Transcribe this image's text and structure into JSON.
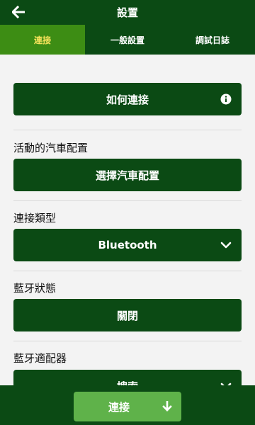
{
  "header": {
    "title": "設置",
    "back_icon": "arrow-left-icon"
  },
  "tabs": [
    {
      "label": "連接",
      "active": true
    },
    {
      "label": "一般設置",
      "active": false
    },
    {
      "label": "調試日誌",
      "active": false
    }
  ],
  "sections": {
    "how_to_connect": {
      "label": "如何連接",
      "icon": "info-icon"
    },
    "active_car_profile": {
      "label": "活動的汽車配置",
      "button": "選擇汽車配置"
    },
    "connection_type": {
      "label": "連接類型",
      "value": "Bluetooth",
      "icon": "chevron-down-icon"
    },
    "bluetooth_status": {
      "label": "藍牙狀態",
      "button": "關閉"
    },
    "bluetooth_adapter": {
      "label": "藍牙適配器",
      "button": "搜索"
    }
  },
  "footer": {
    "connect_label": "連接",
    "icon": "download-icon"
  },
  "colors": {
    "primary": "#0b4a14",
    "tab_active": "#3d8d14",
    "tab_active_text": "#f5e25a",
    "connect": "#5fb24a"
  }
}
